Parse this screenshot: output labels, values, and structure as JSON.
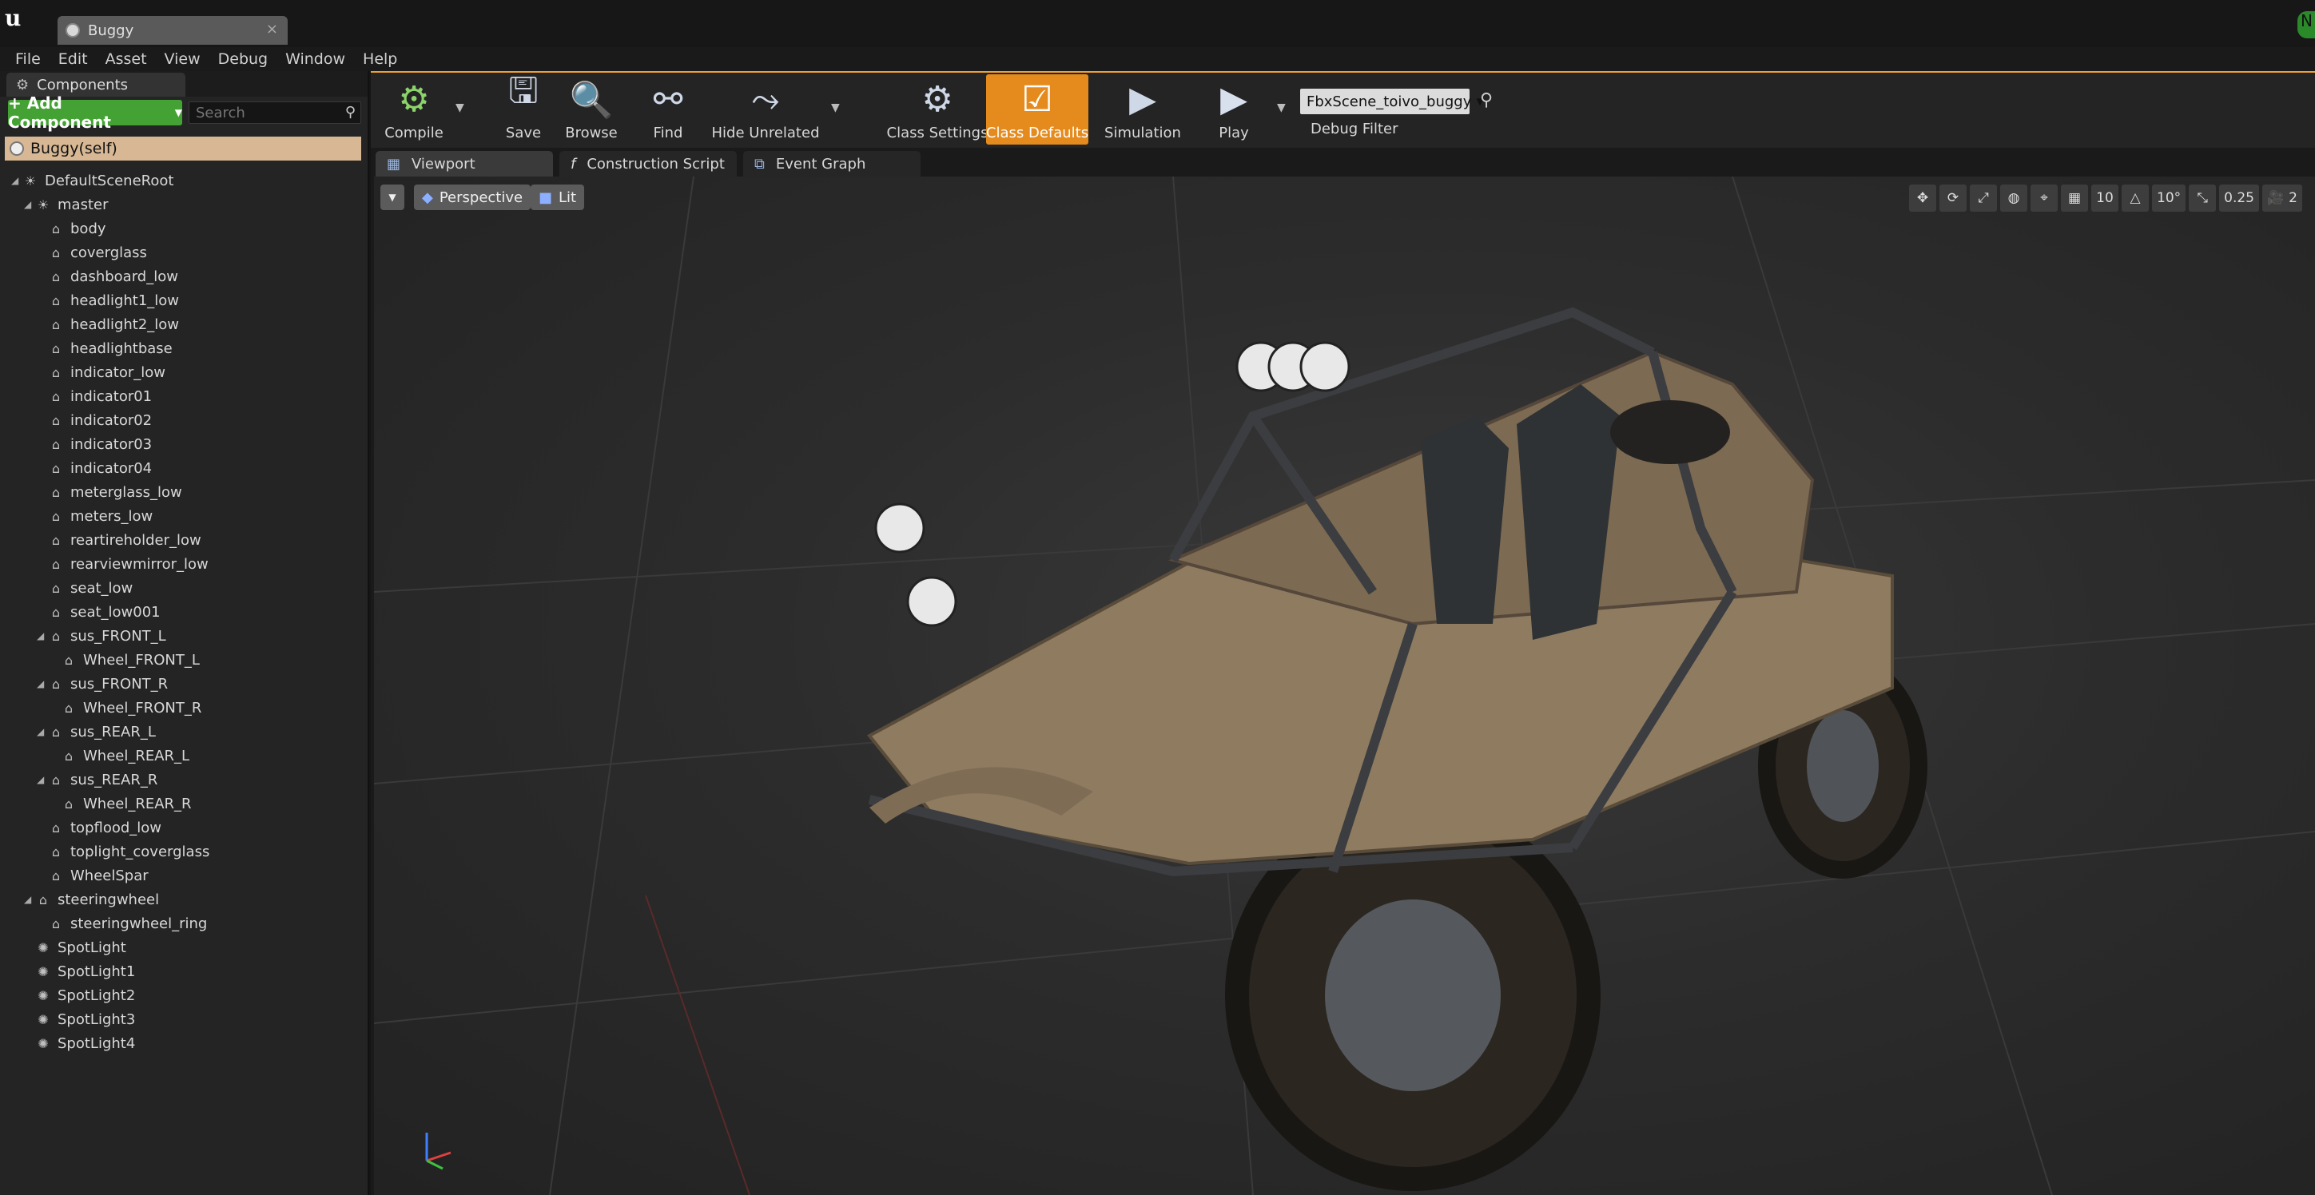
{
  "window": {
    "tab_title": "Buggy"
  },
  "menu": [
    "File",
    "Edit",
    "Asset",
    "View",
    "Debug",
    "Window",
    "Help"
  ],
  "components_panel": {
    "tab_label": "Components",
    "add_button": "+ Add Component",
    "search_placeholder": "Search",
    "self_item": "Buggy(self)",
    "tree": [
      {
        "label": "DefaultSceneRoot",
        "depth": 0,
        "expanded": true,
        "icon": "scene-root-icon"
      },
      {
        "label": "master",
        "depth": 1,
        "expanded": true,
        "icon": "scene-root-icon"
      },
      {
        "label": "body",
        "depth": 2,
        "icon": "mesh-icon"
      },
      {
        "label": "coverglass",
        "depth": 2,
        "icon": "mesh-icon"
      },
      {
        "label": "dashboard_low",
        "depth": 2,
        "icon": "mesh-icon"
      },
      {
        "label": "headlight1_low",
        "depth": 2,
        "icon": "mesh-icon"
      },
      {
        "label": "headlight2_low",
        "depth": 2,
        "icon": "mesh-icon"
      },
      {
        "label": "headlightbase",
        "depth": 2,
        "icon": "mesh-icon"
      },
      {
        "label": "indicator_low",
        "depth": 2,
        "icon": "mesh-icon"
      },
      {
        "label": "indicator01",
        "depth": 2,
        "icon": "mesh-icon"
      },
      {
        "label": "indicator02",
        "depth": 2,
        "icon": "mesh-icon"
      },
      {
        "label": "indicator03",
        "depth": 2,
        "icon": "mesh-icon"
      },
      {
        "label": "indicator04",
        "depth": 2,
        "icon": "mesh-icon"
      },
      {
        "label": "meterglass_low",
        "depth": 2,
        "icon": "mesh-icon"
      },
      {
        "label": "meters_low",
        "depth": 2,
        "icon": "mesh-icon"
      },
      {
        "label": "reartireholder_low",
        "depth": 2,
        "icon": "mesh-icon"
      },
      {
        "label": "rearviewmirror_low",
        "depth": 2,
        "icon": "mesh-icon"
      },
      {
        "label": "seat_low",
        "depth": 2,
        "icon": "mesh-icon"
      },
      {
        "label": "seat_low001",
        "depth": 2,
        "icon": "mesh-icon"
      },
      {
        "label": "sus_FRONT_L",
        "depth": 2,
        "expanded": true,
        "icon": "mesh-icon"
      },
      {
        "label": "Wheel_FRONT_L",
        "depth": 3,
        "icon": "mesh-icon"
      },
      {
        "label": "sus_FRONT_R",
        "depth": 2,
        "expanded": true,
        "icon": "mesh-icon"
      },
      {
        "label": "Wheel_FRONT_R",
        "depth": 3,
        "icon": "mesh-icon"
      },
      {
        "label": "sus_REAR_L",
        "depth": 2,
        "expanded": true,
        "icon": "mesh-icon"
      },
      {
        "label": "Wheel_REAR_L",
        "depth": 3,
        "icon": "mesh-icon"
      },
      {
        "label": "sus_REAR_R",
        "depth": 2,
        "expanded": true,
        "icon": "mesh-icon"
      },
      {
        "label": "Wheel_REAR_R",
        "depth": 3,
        "icon": "mesh-icon"
      },
      {
        "label": "topflood_low",
        "depth": 2,
        "icon": "mesh-icon"
      },
      {
        "label": "toplight_coverglass",
        "depth": 2,
        "icon": "mesh-icon"
      },
      {
        "label": "WheelSpar",
        "depth": 2,
        "icon": "mesh-icon"
      },
      {
        "label": "steeringwheel",
        "depth": 1,
        "expanded": true,
        "icon": "mesh-icon"
      },
      {
        "label": "steeringwheel_ring",
        "depth": 2,
        "icon": "mesh-icon"
      },
      {
        "label": "SpotLight",
        "depth": 1,
        "icon": "spotlight-icon"
      },
      {
        "label": "SpotLight1",
        "depth": 1,
        "icon": "spotlight-icon"
      },
      {
        "label": "SpotLight2",
        "depth": 1,
        "icon": "spotlight-icon"
      },
      {
        "label": "SpotLight3",
        "depth": 1,
        "icon": "spotlight-icon"
      },
      {
        "label": "SpotLight4",
        "depth": 1,
        "icon": "spotlight-icon"
      }
    ]
  },
  "toolbar": {
    "compile": "Compile",
    "save": "Save",
    "browse": "Browse",
    "find": "Find",
    "hide_unrelated": "Hide Unrelated",
    "class_settings": "Class Settings",
    "class_defaults": "Class Defaults",
    "simulation": "Simulation",
    "play": "Play",
    "debug_filter_value": "FbxScene_toivo_buggy",
    "debug_filter_label": "Debug Filter",
    "accent_color": "#e58b1d"
  },
  "editor_tabs": {
    "viewport": "Viewport",
    "construction_script": "Construction Script",
    "event_graph": "Event Graph"
  },
  "viewport": {
    "view_mode": "Perspective",
    "lighting_mode": "Lit",
    "grid_snap": "10",
    "rotation_snap": "10°",
    "scale_snap": "0.25",
    "camera_speed": "2"
  }
}
